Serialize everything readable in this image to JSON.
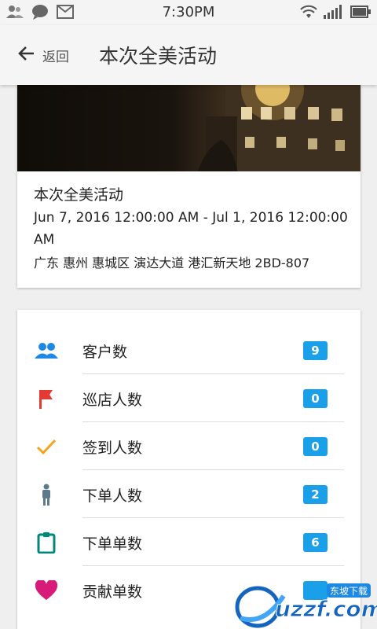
{
  "status_bar": {
    "time": "7:30PM"
  },
  "app_bar": {
    "back_label": "返回",
    "title": "本次全美活动"
  },
  "event": {
    "title": "本次全美活动",
    "time_range": "Jun 7, 2016 12:00:00 AM - Jul 1, 2016 12:00:00 AM",
    "address": "广东 惠州 惠城区 演达大道 港汇新天地 2BD-807"
  },
  "stats": [
    {
      "label": "客户数",
      "value": "9",
      "icon": "people-icon",
      "color": "#1e88e5"
    },
    {
      "label": "巡店人数",
      "value": "0",
      "icon": "flag-icon",
      "color": "#e53935"
    },
    {
      "label": "签到人数",
      "value": "0",
      "icon": "check-icon",
      "color": "#f2a51a"
    },
    {
      "label": "下单人数",
      "value": "2",
      "icon": "person-icon",
      "color": "#5d7a8c"
    },
    {
      "label": "下单单数",
      "value": "6",
      "icon": "clipboard-icon",
      "color": "#00897b"
    },
    {
      "label": "贡献单数",
      "value": "",
      "icon": "heart-icon",
      "color": "#d81b79"
    }
  ],
  "colors": {
    "badge": "#1aa0e8",
    "app_bar_bg": "#f5f5f5"
  },
  "watermark": {
    "brand": "uzzf.com",
    "tag": "东坡下载"
  }
}
